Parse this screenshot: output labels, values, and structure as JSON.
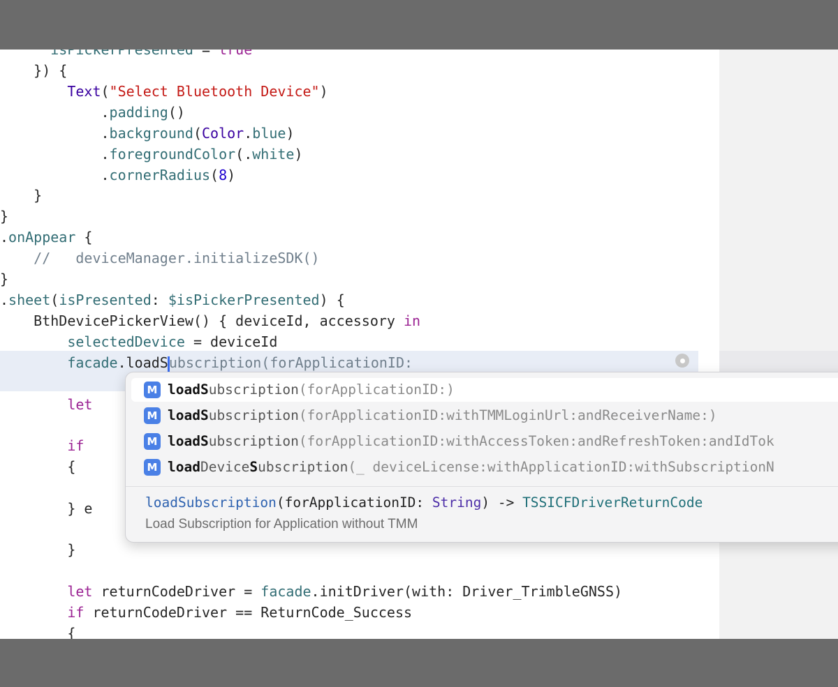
{
  "code": {
    "line0": {
      "indent": "      ",
      "a": "isPickerPresented",
      "b": " = ",
      "c": "true"
    },
    "line1": "    }) {",
    "line2": {
      "indent": "        ",
      "type": "Text",
      "open": "(",
      "str": "\"Select Bluetooth Device\"",
      "close": ")"
    },
    "line3": {
      "indent": "            ",
      "dot": ".",
      "fn": "padding",
      "rest": "()"
    },
    "line4": {
      "indent": "            ",
      "dot": ".",
      "fn": "background",
      "p1": "(",
      "type": "Color",
      "dot2": ".",
      "member": "blue",
      "p2": ")"
    },
    "line5": {
      "indent": "            ",
      "dot": ".",
      "fn": "foregroundColor",
      "p1": "(.",
      "member": "white",
      "p2": ")"
    },
    "line6": {
      "indent": "            ",
      "dot": ".",
      "fn": "cornerRadius",
      "p1": "(",
      "num": "8",
      "p2": ")"
    },
    "line7": "    }",
    "line8": "}",
    "line9": {
      "dot": ".",
      "fn": "onAppear",
      "rest": " {"
    },
    "line10": {
      "indent": "    ",
      "comment": "//   deviceManager.initializeSDK()"
    },
    "line11": "}",
    "line12": {
      "dot": ".",
      "fn": "sheet",
      "p1": "(",
      "lbl": "isPresented",
      "colon": ": ",
      "var": "$isPickerPresented",
      "rest": ") {"
    },
    "line13": {
      "indent": "    ",
      "name": "BthDevicePickerView",
      "rest": "() { deviceId, accessory ",
      "kw": "in"
    },
    "line14": {
      "indent": "        ",
      "var": "selectedDevice",
      "rest": " = deviceId"
    },
    "line15": {
      "indent": "        ",
      "var": "facade",
      "dot": ".",
      "typed": "loadS",
      "ghost": "ubscription(forApplicationID:"
    },
    "line17": {
      "indent": "        ",
      "kw": "let"
    },
    "line19": {
      "indent": "        ",
      "kw": "if"
    },
    "line20": {
      "indent": "        ",
      "rest": "{"
    },
    "line22": {
      "indent": "        ",
      "rest": "} e"
    },
    "line24": {
      "indent": "        ",
      "rest": "}"
    },
    "line26": {
      "indent": "        ",
      "kw": "let",
      "rest1": " returnCodeDriver = ",
      "var": "facade",
      "rest2": ".initDriver(with: Driver_TrimbleGNSS)"
    },
    "line27": {
      "indent": "        ",
      "kw": "if",
      "rest": " returnCodeDriver == ReturnCode_Success"
    },
    "line28": {
      "indent": "        ",
      "rest": "{"
    }
  },
  "autocomplete": {
    "badge": "M",
    "items": [
      {
        "bold": "loadS",
        "name": "ubscription",
        "args": "(forApplicationID:)"
      },
      {
        "bold": "loadS",
        "name": "ubscription",
        "args": "(forApplicationID:withTMMLoginUrl:andReceiverName:)"
      },
      {
        "bold": "loadS",
        "name": "ubscription",
        "args": "(forApplicationID:withAccessToken:andRefreshToken:andIdTok"
      },
      {
        "bold1": "load",
        "name1": "Device",
        "bold2": "S",
        "name2": "ubscription",
        "args": "(_ deviceLicense:withApplicationID:withSubscriptionN"
      }
    ],
    "signature": {
      "fn": "loadSubscription",
      "p1": "(forApplicationID: ",
      "type": "String",
      "p2": ") -> ",
      "ret": "TSSICFDriverReturnCode"
    },
    "description": "Load Subscription for Application without TMM"
  }
}
